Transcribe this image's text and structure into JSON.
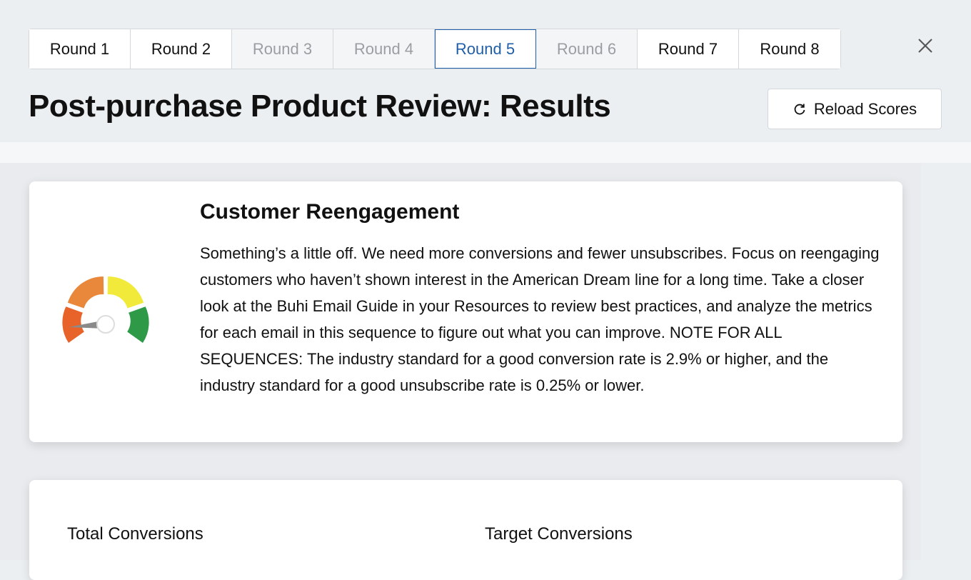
{
  "tabs": [
    {
      "label": "Round 1",
      "state": "normal"
    },
    {
      "label": "Round 2",
      "state": "normal"
    },
    {
      "label": "Round 3",
      "state": "disabled"
    },
    {
      "label": "Round 4",
      "state": "disabled"
    },
    {
      "label": "Round 5",
      "state": "active"
    },
    {
      "label": "Round 6",
      "state": "disabled"
    },
    {
      "label": "Round 7",
      "state": "normal"
    },
    {
      "label": "Round 8",
      "state": "normal"
    }
  ],
  "header": {
    "title": "Post-purchase Product Review: Results",
    "reload_label": "Reload Scores",
    "close_icon": "close-icon",
    "reload_icon": "refresh-icon"
  },
  "feedback": {
    "gauge_icon": "gauge-icon",
    "title": "Customer Reengagement",
    "body": "Something’s a little off. We need more conversions and fewer unsubscribes. Focus on reengaging customers who haven’t shown interest in the American Dream line for a long time. Take a closer look at the Buhi Email Guide in your Resources to review best practices, and analyze the metrics for each email in this sequence to figure out what you can improve. NOTE FOR ALL SEQUENCES: The industry standard for a good conversion rate is 2.9% or higher, and the industry standard for a good unsubscribe rate is 0.25% or lower."
  },
  "metrics": {
    "total_label": "Total Conversions",
    "target_label": "Target Conversions"
  },
  "colors": {
    "active_tab": "#1f5ea8",
    "gauge_red": "#e8632a",
    "gauge_orange": "#e9873a",
    "gauge_yellow": "#f2ea3a",
    "gauge_green": "#2e9a47"
  }
}
